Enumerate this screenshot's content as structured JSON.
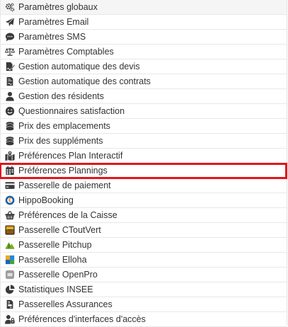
{
  "menu": {
    "items": [
      {
        "label": "Paramètres globaux",
        "icon": "gears-icon"
      },
      {
        "label": "Paramètres Email",
        "icon": "paper-plane-icon"
      },
      {
        "label": "Paramètres SMS",
        "icon": "sms-bubble-icon"
      },
      {
        "label": "Paramètres Comptables",
        "icon": "balance-scale-icon"
      },
      {
        "label": "Gestion automatique des devis",
        "icon": "file-signature-icon"
      },
      {
        "label": "Gestion automatique des contrats",
        "icon": "file-contract-icon"
      },
      {
        "label": "Gestion des résidents",
        "icon": "user-icon"
      },
      {
        "label": "Questionnaires satisfaction",
        "icon": "smile-icon"
      },
      {
        "label": "Prix des emplacements",
        "icon": "coins-icon"
      },
      {
        "label": "Prix des suppléments",
        "icon": "coins-icon"
      },
      {
        "label": "Préférences Plan Interactif",
        "icon": "map-marked-icon"
      },
      {
        "label": "Préférences Plannings",
        "icon": "calendar-icon"
      },
      {
        "label": "Passerelle de paiement",
        "icon": "credit-card-icon"
      },
      {
        "label": "HippoBooking",
        "icon": "hippobooking-logo-icon"
      },
      {
        "label": "Préférences de la Caisse",
        "icon": "shopping-basket-icon"
      },
      {
        "label": "Passerelle CToutVert",
        "icon": "ctoutvert-logo-icon"
      },
      {
        "label": "Passerelle Pitchup",
        "icon": "pitchup-logo-icon"
      },
      {
        "label": "Passerelle Elloha",
        "icon": "elloha-logo-icon"
      },
      {
        "label": "Passerelle OpenPro",
        "icon": "openpro-logo-icon"
      },
      {
        "label": "Statistiques INSEE",
        "icon": "pie-chart-icon"
      },
      {
        "label": "Passerelles Assurances",
        "icon": "file-invoice-icon"
      },
      {
        "label": "Préférences d'interfaces d'accès",
        "icon": "user-lock-icon"
      }
    ],
    "highlighted_item": "Préférences Plannings",
    "highlight_color": "#e3151c"
  }
}
